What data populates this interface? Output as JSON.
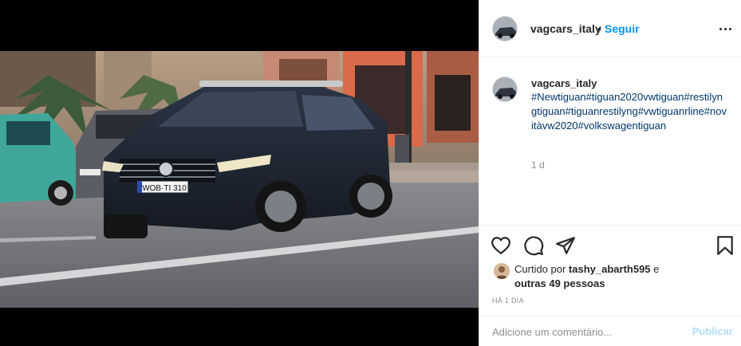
{
  "post": {
    "username": "vagcars_italy",
    "separator": "•",
    "follow_label": "Seguir",
    "caption_username": "vagcars_italy",
    "caption_text": "#Newtiguan#tiguan2020vwtiguan#restilyngtiguan#tiguanrestilyng#vwtiguanrline#novitàvw2020#volkswagentiguan",
    "caption_time": "1 d",
    "image_plate": "WOB·TI 310",
    "liked_prefix": "Curtido por ",
    "liked_user": "tashy_abarth595",
    "liked_suffix": " e",
    "liked_others": "outras 49 pessoas",
    "posted_ago": "HÁ 1 DIA",
    "comment_placeholder": "Adicione um comentário...",
    "publish_label": "Publicar"
  },
  "icons": {
    "more": "more-options-icon",
    "like": "heart-icon",
    "comment": "comment-icon",
    "share": "paper-plane-icon",
    "save": "bookmark-icon"
  },
  "colors": {
    "link": "#0095f6",
    "hashtag": "#00376b",
    "muted": "#8e8e8e",
    "publish_disabled": "#b2dffc"
  }
}
